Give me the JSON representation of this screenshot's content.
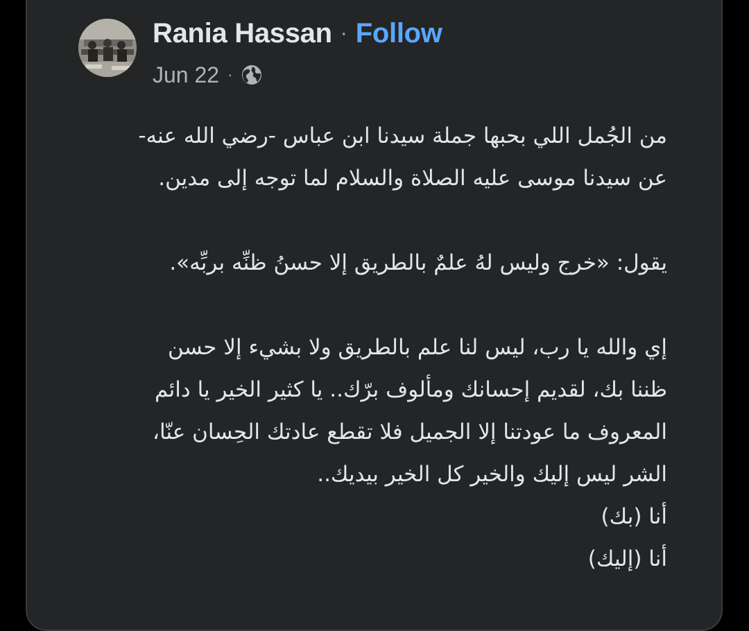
{
  "post": {
    "author": "Rania Hassan",
    "separator": "·",
    "follow_label": "Follow",
    "date": "Jun 22",
    "meta_separator": "·",
    "audience_icon": "globe-icon",
    "lines": [
      "من الجُمل اللي بحبها جملة سيدنا ابن عباس -رضي الله عنه-",
      "عن سيدنا موسى عليه الصلاة والسلام لما توجه إلى مدين.",
      "",
      "يقول: «خرج وليس لهُ علمٌ بالطريق إلا حسنُ ظنِّه بربِّه».",
      "",
      "إي والله يا رب، ليس لنا علم بالطريق ولا بشيء إلا حسن",
      "ظننا بك، لقديم إحسانك ومألوف برّك.. يا كثير الخير يا دائم",
      "المعروف ما عودتنا إلا الجميل فلا تقطع عادتك الحِسان عنّا،",
      "الشر ليس إليك والخير كل الخير بيديك..  ",
      "أنا (بك)",
      "أنا (إليك)"
    ]
  },
  "colors": {
    "background": "#000000",
    "card": "#242526",
    "text_primary": "#e4e6eb",
    "text_secondary": "#b0b3b8",
    "link": "#5aa7ff"
  }
}
